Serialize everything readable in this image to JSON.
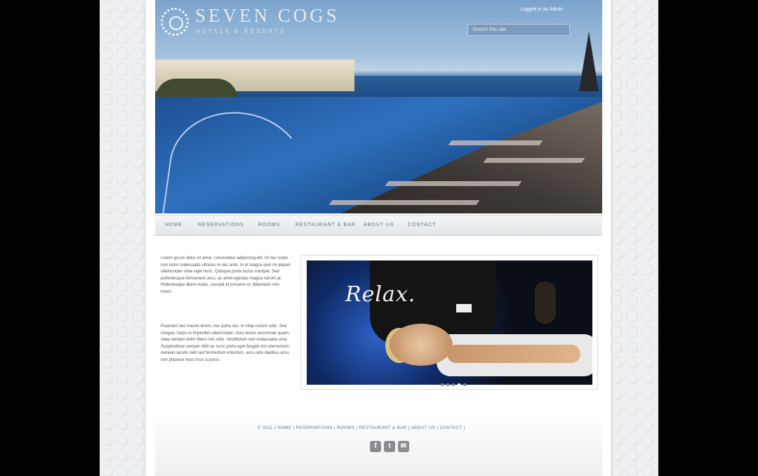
{
  "brand": {
    "title": "SEVEN COGS",
    "subtitle": "HOTELS & RESORTS"
  },
  "header": {
    "login_text": "Logged in as Admin",
    "search_placeholder": "Search this site"
  },
  "nav": {
    "items": [
      "HOME",
      "RESERVATIONS",
      "ROOMS",
      "RESTAURANT & BAR",
      "ABOUT US",
      "CONTACT"
    ]
  },
  "content": {
    "paragraph_1": "Lorem ipsum dolor sit amet, consectetur adipiscing elit. Ut nec turpis non tortor malesuada ultricies in nec ante. In et magna quis mi aliquet ullamcorper vitae eget nunc. Quisque porta luctus volutpat. Sed pellentesque fermentum arcu, ac amet egestas magna rutrum at. Pellentesque libero turpis, suscipit et posuere ut, bibendum non lorem.",
    "paragraph_2": "Praesent nec mauris lorem, nec porta nisi. In vitae rutrum odio. Sed congue, turpis in imperdiet ullamcorper, risus lectus accumsan quam, vitae semper dolor libero non odio. Vestibulum non malesuada urna. Suspendisse semper nibh ac nunc porta eget feugiat orci elementum. Aenean iaculis velit sed fermentum interdum, arcu odio dapibus arcu, non placerat risus risus a purus.",
    "slide_caption": "Relax."
  },
  "slider": {
    "dot_count": 5,
    "active_index": 3
  },
  "footer": {
    "text": "© 2011 | HOME | RESERVATIONS | ROOMS | RESTAURANT & BAR | ABOUT US | CONTACT |",
    "social": [
      {
        "icon": "facebook-icon",
        "glyph": "f"
      },
      {
        "icon": "twitter-icon",
        "glyph": "t"
      },
      {
        "icon": "email-icon",
        "glyph": "✉"
      }
    ]
  },
  "colors": {
    "nav_text": "#5d7284",
    "page_bg": "#ffffff",
    "pattern_bg": "#eef0f2"
  }
}
